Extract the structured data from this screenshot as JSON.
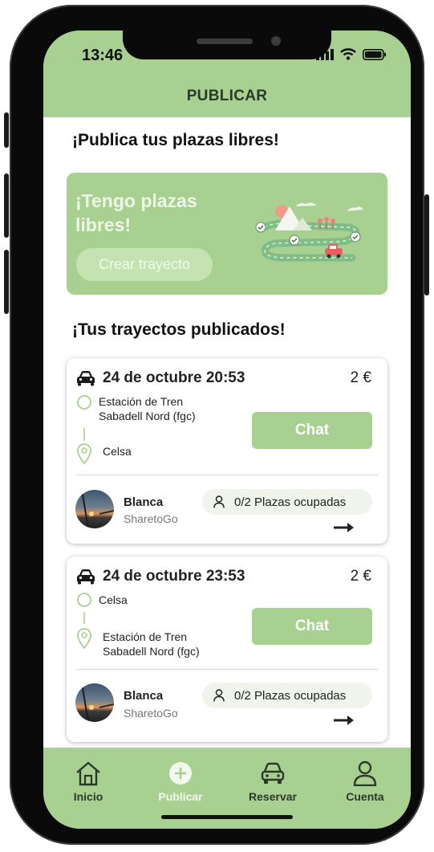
{
  "status_bar": {
    "time": "13:46"
  },
  "header": {
    "title": "PUBLICAR"
  },
  "publish_section": {
    "title": "¡Publica tus plazas libres!",
    "promo_title": "¡Tengo plazas libres!",
    "create_button": "Crear trayecto"
  },
  "trips_section": {
    "title": "¡Tus trayectos publicados!"
  },
  "trips": [
    {
      "date": "24 de octubre 20:53",
      "price": "2 €",
      "origin": "Estación de Tren Sabadell Nord (fgc)",
      "destination": "Celsa",
      "chat_label": "Chat",
      "driver_name": "Blanca",
      "driver_org": "SharetoGo",
      "seats": "0/2 Plazas ocupadas"
    },
    {
      "date": "24 de octubre 23:53",
      "price": "2 €",
      "origin": "Celsa",
      "destination": "Estación de Tren Sabadell Nord (fgc)",
      "chat_label": "Chat",
      "driver_name": "Blanca",
      "driver_org": "SharetoGo",
      "seats": "0/2 Plazas ocupadas"
    }
  ],
  "tabbar": {
    "items": [
      {
        "label": "Inicio",
        "icon": "home-icon"
      },
      {
        "label": "Publicar",
        "icon": "plus-circle-icon",
        "active": true
      },
      {
        "label": "Reservar",
        "icon": "car-icon"
      },
      {
        "label": "Cuenta",
        "icon": "user-icon"
      }
    ]
  },
  "colors": {
    "accent": "#a8d090",
    "light_accent": "#c5e2b3",
    "text": "#222222"
  }
}
